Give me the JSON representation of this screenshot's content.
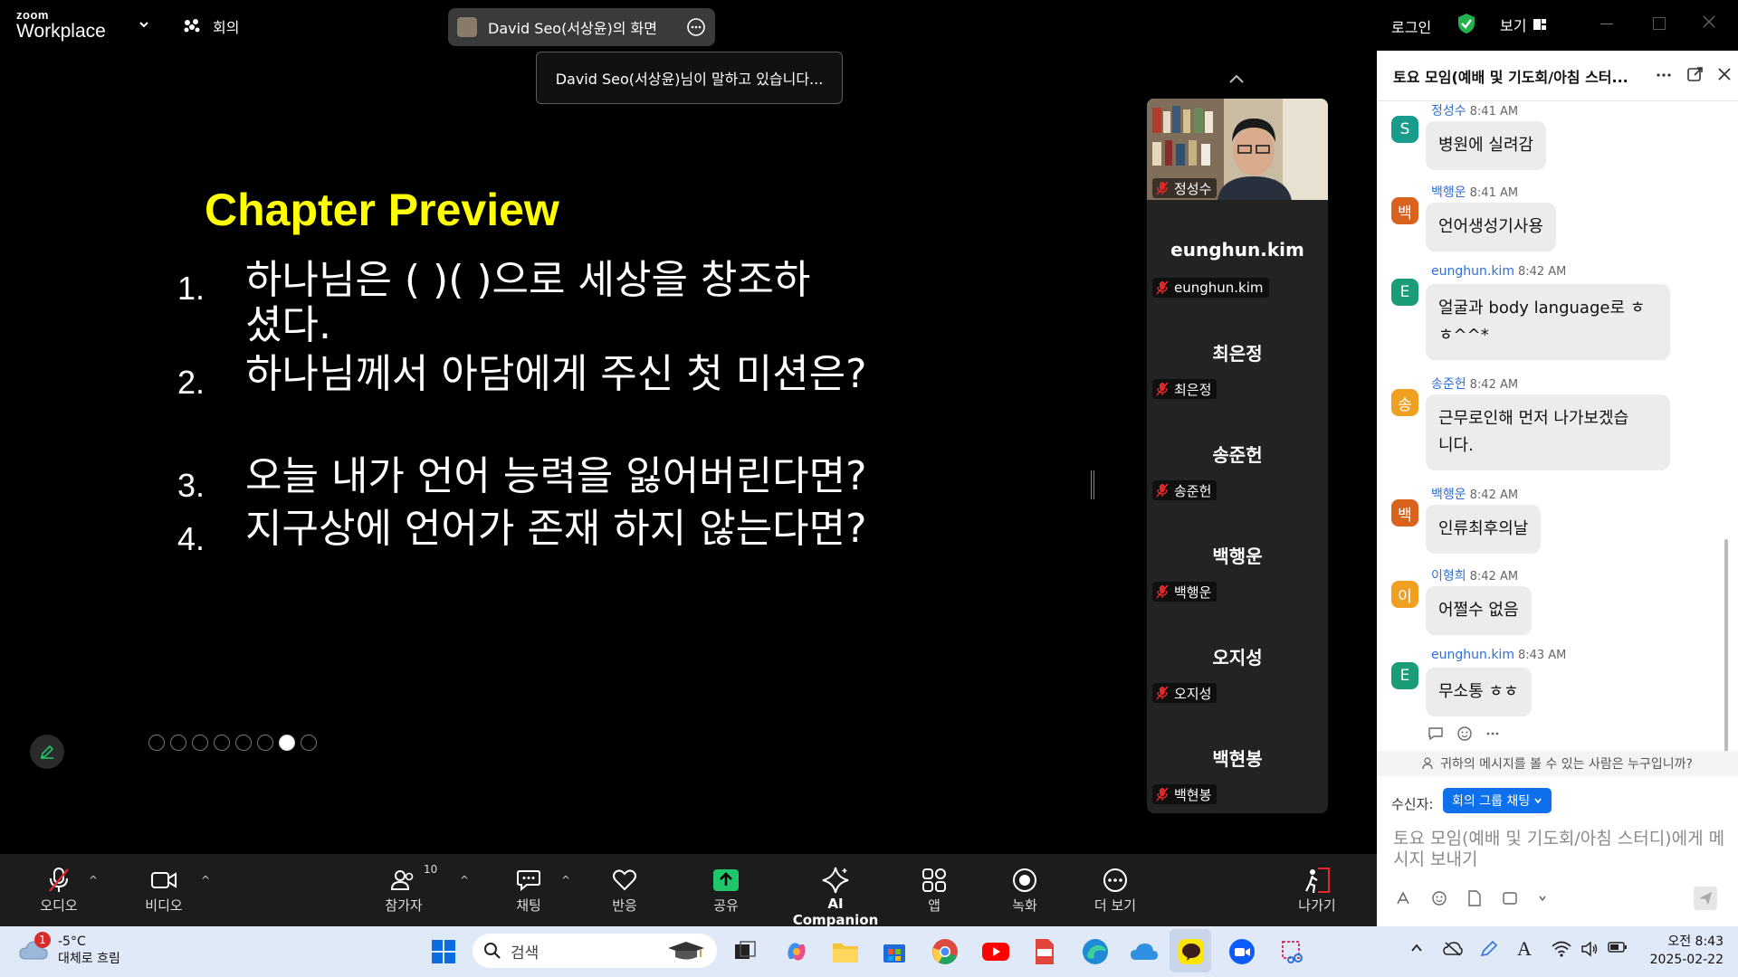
{
  "app": {
    "logo_small": "zoom",
    "logo_big": "Workplace",
    "meetings_label": "회의",
    "share_title": "David Seo(서상윤)의 화면",
    "speaking_banner": "David Seo(서상윤)님이 말하고 있습니다...",
    "login_label": "로그인",
    "view_label": "보기"
  },
  "slide": {
    "title": "Chapter Preview",
    "items": [
      {
        "num": "1.",
        "text_line1": "하나님은 (     )(     )으로 세상을 창조하",
        "text_line2": "셨다."
      },
      {
        "num": "2.",
        "text_line1": "하나님께서 아담에게 주신 첫 미션은?"
      },
      {
        "num": "3.",
        "text_line1": "오늘 내가 언어 능력을 잃어버린다면?"
      },
      {
        "num": "4.",
        "text_line1": "지구상에 언어가 존재 하지 않는다면?"
      }
    ]
  },
  "participants": {
    "video_name": "정성수",
    "list": [
      {
        "big": "eunghun.kim",
        "small": "eunghun.kim"
      },
      {
        "big": "최은정",
        "small": "최은정"
      },
      {
        "big": "송준헌",
        "small": "송준헌"
      },
      {
        "big": "백행운",
        "small": "백행운"
      },
      {
        "big": "오지성",
        "small": "오지성"
      },
      {
        "big": "백현봉",
        "small": "백현봉"
      }
    ]
  },
  "chat": {
    "title": "토요 모임(예배 및 기도회/아침 스터...",
    "messages": [
      {
        "avatar": "S",
        "color": "#1a9c8c",
        "name": "정성수",
        "time": "8:41 AM",
        "lines": [
          "병원에 실려감"
        ]
      },
      {
        "avatar": "백",
        "color": "#d9631e",
        "name": "백행운",
        "time": "8:41 AM",
        "lines": [
          "언어생성기사용"
        ]
      },
      {
        "avatar": "E",
        "color": "#1a9c78",
        "name": "eunghun.kim",
        "time": "8:42 AM",
        "lines": [
          "얼굴과 body language로 ㅎ",
          "ㅎ^^*"
        ]
      },
      {
        "avatar": "송",
        "color": "#f0a020",
        "name": "송준헌",
        "time": "8:42 AM",
        "lines": [
          "근무로인해 먼저 나가보겠습",
          "니다."
        ]
      },
      {
        "avatar": "백",
        "color": "#d9631e",
        "name": "백행운",
        "time": "8:42 AM",
        "lines": [
          "인류최후의날"
        ]
      },
      {
        "avatar": "이",
        "color": "#f0a020",
        "name": "이형희",
        "time": "8:42 AM",
        "lines": [
          "어쩔수 없음"
        ]
      },
      {
        "avatar": "E",
        "color": "#1a9c78",
        "name": "eunghun.kim",
        "time": "8:43 AM",
        "lines": [
          "무소통 ㅎㅎ"
        ]
      }
    ],
    "visibility_note": "귀하의 메시지를 볼 수 있는 사람은 누구입니까?",
    "recipient_label": "수신자:",
    "recipient_value": "회의 그룹 채팅",
    "input_placeholder": "토요 모임(예배 및 기도회/아침 스터디)에게 메시지 보내기"
  },
  "toolbar": {
    "audio": "오디오",
    "video": "비디오",
    "participants": "참가자",
    "participants_count": "10",
    "chat": "채팅",
    "react": "반응",
    "share": "공유",
    "ai": "AI Companion",
    "apps": "앱",
    "record": "녹화",
    "more": "더 보기",
    "leave": "나가기"
  },
  "taskbar": {
    "weather_badge": "1",
    "temp": "-5°C",
    "weather": "대체로 흐림",
    "search_placeholder": "검색",
    "time": "오전 8:43",
    "date": "2025-02-22"
  }
}
